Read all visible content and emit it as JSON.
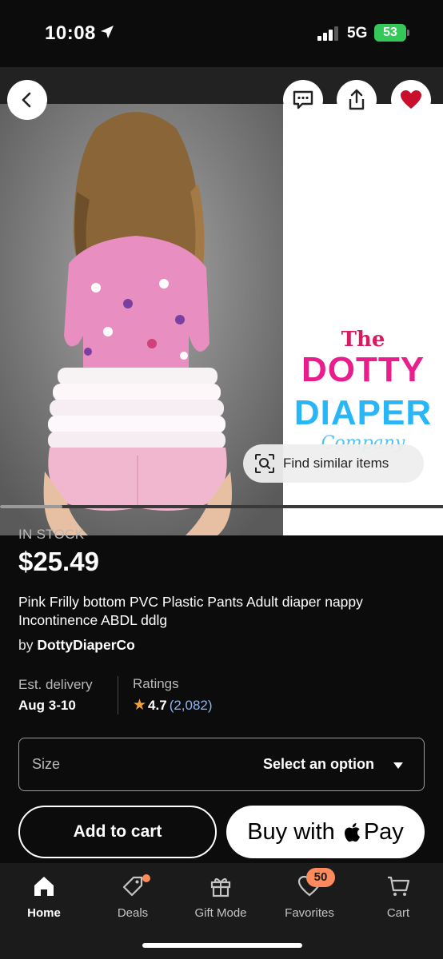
{
  "status_bar": {
    "time": "10:08",
    "network": "5G",
    "battery": "53",
    "icons": [
      "location-arrow-icon",
      "signal-bars-icon",
      "battery-icon"
    ]
  },
  "image_gallery": {
    "logo": {
      "line1": "The",
      "line2": "DOTTY",
      "line3": "DIAPER",
      "line4": "Company"
    },
    "find_similar_label": "Find similar items",
    "scroll_progress": 0.14,
    "icons": [
      "back-chevron-icon",
      "message-icon",
      "share-icon",
      "heart-icon",
      "visual-search-icon"
    ]
  },
  "listing": {
    "stock_status": "IN STOCK",
    "price": "$25.49",
    "title": "Pink Frilly bottom PVC Plastic Pants Adult diaper nappy Incontinence ABDL ddlg",
    "seller_prefix": "by",
    "seller_name": "DottyDiaperCo",
    "delivery_label": "Est. delivery",
    "delivery_value": "Aug 3-10",
    "ratings_label": "Ratings",
    "rating_value": "4.7",
    "rating_count": "(2,082)"
  },
  "size_select": {
    "label": "Size",
    "value": "Select an option"
  },
  "actions": {
    "add_to_cart": "Add to cart",
    "buy_prefix": "Buy with",
    "buy_pay": "Pay"
  },
  "bottom_nav": {
    "items": [
      {
        "label": "Home",
        "icon": "home-icon",
        "active": true
      },
      {
        "label": "Deals",
        "icon": "tag-icon"
      },
      {
        "label": "Gift Mode",
        "icon": "gift-icon"
      },
      {
        "label": "Favorites",
        "icon": "heart-outline-icon",
        "badge": "50"
      },
      {
        "label": "Cart",
        "icon": "cart-icon"
      }
    ]
  },
  "colors": {
    "background": "#0c0c0c",
    "favorite": "#c8102e",
    "badge": "#ff8a5b",
    "link": "#8ab4f8",
    "star": "#f1a33a",
    "battery": "#34c759"
  }
}
